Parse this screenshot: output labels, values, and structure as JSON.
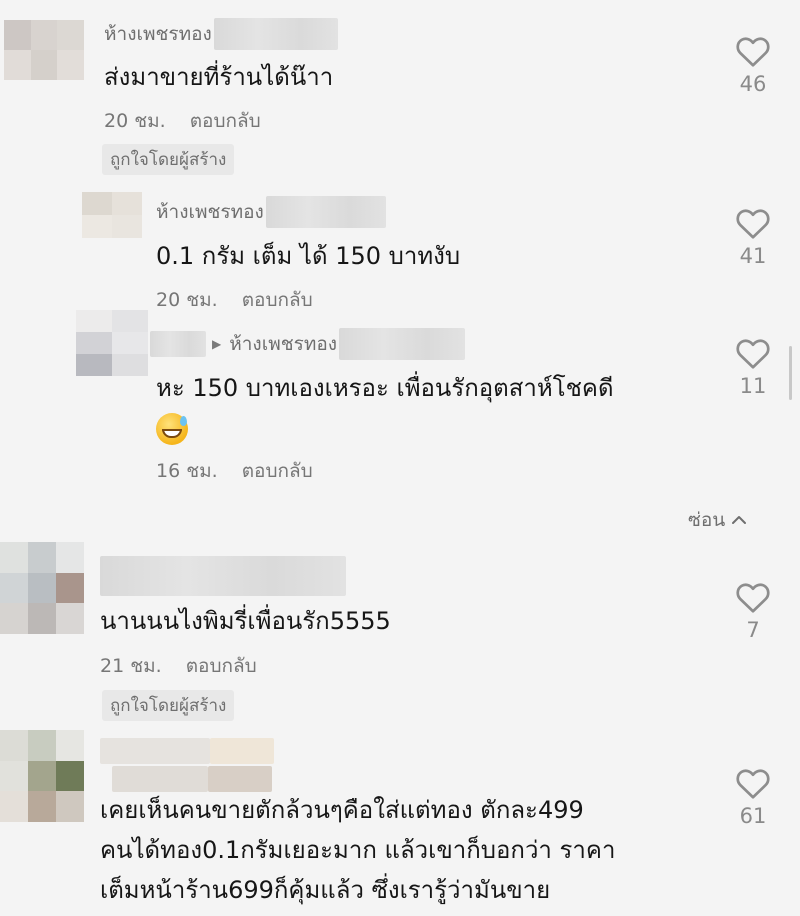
{
  "comments": [
    {
      "name": "ห้างเพชรทอง",
      "text": "ส่งมาขายที่ร้านได้น๊าา",
      "time": "20 ชม.",
      "reply_label": "ตอบกลับ",
      "badge": "ถูกใจโดยผู้สร้าง",
      "likes": "46",
      "avatar_colors": [
        "#cdc7c4",
        "#d8d3cf",
        "#dcd8d3",
        "#e1dcd8",
        "#d5d0cb",
        "#e2ddd9"
      ]
    },
    {
      "name": "ห้างเพชรทอง",
      "text": "0.1 กรัม เต็ม ได้ 150 บาทงับ",
      "time": "20 ชม.",
      "reply_label": "ตอบกลับ",
      "likes": "41",
      "avatar_colors": [
        "#ddd8d0",
        "#e6e1da",
        "#ece8e2",
        "#e9e5df"
      ]
    },
    {
      "reply_to": "ห้างเพชรทอง",
      "text_line1": "หะ 150 บาทเองเหรอะ เพื่อนรักอุตสาห์โชคดี",
      "time": "16 ชม.",
      "reply_label": "ตอบกลับ",
      "likes": "11",
      "avatar_colors": [
        "#ecebeb",
        "#e3e3e5",
        "#d2d2d6",
        "#e7e7e9",
        "#b8b9bf",
        "#dedee0"
      ]
    },
    {
      "text": "นานนนไงพิมรี่เพื่อนรัก5555",
      "time": "21 ชม.",
      "reply_label": "ตอบกลับ",
      "badge": "ถูกใจโดยผู้สร้าง",
      "likes": "7",
      "avatar_colors": [
        "#dfe1df",
        "#c8ccce",
        "#b9bec2",
        "#a9958c",
        "#d6d3d0",
        "#bcb8b6",
        "#d9d6d4",
        "#e4e2e0",
        "#cfcdcb"
      ]
    },
    {
      "line1": "เคยเห็นคนขายตักล้วนๆคือใส่แต่ทอง ตักละ499",
      "line2": "คนได้ทอง0.1กรัมเยอะมาก แล้วเขาก็บอกว่า ราคา",
      "line3": "เต็มหน้าร้าน699ก็คุ้มแล้ว ซึ่งเรารู้ว่ามันขาย",
      "likes": "61",
      "avatar_colors": [
        "#dcdcd6",
        "#c8ccc0",
        "#a3a58d",
        "#6f7b58",
        "#efe6d8",
        "#b8a99a",
        "#d8cfc6",
        "#cfc8bf",
        "#e4dfd9"
      ]
    }
  ],
  "hide_label": "ซ่อน",
  "icons": {
    "like": "heart-outline-icon",
    "hide": "chevron-up-icon",
    "reply_arrow": "reply-triangle-icon",
    "emoji": "grinning-sweat-emoji"
  },
  "colors": {
    "background": "#f4f4f4",
    "text": "#161616",
    "meta": "#767676",
    "badge_bg": "#e8e8e8"
  }
}
